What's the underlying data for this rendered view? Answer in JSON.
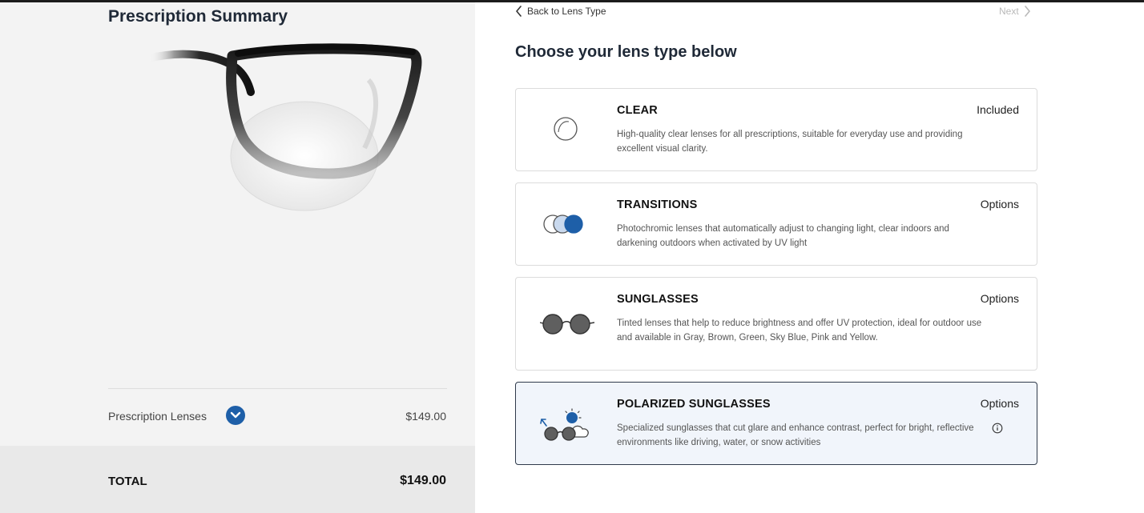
{
  "summary": {
    "title": "Prescription Summary",
    "lens_label": "Prescription Lenses",
    "lens_price": "$149.00",
    "total_label": "TOTAL",
    "total_value": "$149.00"
  },
  "nav": {
    "back_label": "Back to Lens Type",
    "next_label": "Next"
  },
  "main": {
    "heading": "Choose your lens type below",
    "options": [
      {
        "title": "CLEAR",
        "tag": "Included",
        "description": "High-quality clear lenses for all prescriptions, suitable for everyday use and providing excellent visual clarity.",
        "icon": "clear-lens-icon",
        "selected": false
      },
      {
        "title": "TRANSITIONS",
        "tag": "Options",
        "description": "Photochromic lenses that automatically adjust to changing light, clear indoors and darkening outdoors when activated by UV light",
        "icon": "transitions-lens-icon",
        "selected": false
      },
      {
        "title": "SUNGLASSES",
        "tag": "Options",
        "description": "Tinted lenses that help to reduce brightness and offer UV protection, ideal for outdoor use and available in Gray, Brown, Green, Sky Blue, Pink and Yellow.",
        "icon": "sunglasses-lens-icon",
        "selected": false
      },
      {
        "title": "POLARIZED SUNGLASSES",
        "tag": "Options",
        "description": "Specialized sunglasses that cut glare and enhance contrast, perfect for bright, reflective environments like driving, water, or snow activities",
        "icon": "polarized-lens-icon",
        "selected": true
      }
    ]
  },
  "colors": {
    "accent": "#1e5fa8",
    "selected_bg": "#f1f5fb",
    "lens_gray": "#5f5f5f"
  }
}
